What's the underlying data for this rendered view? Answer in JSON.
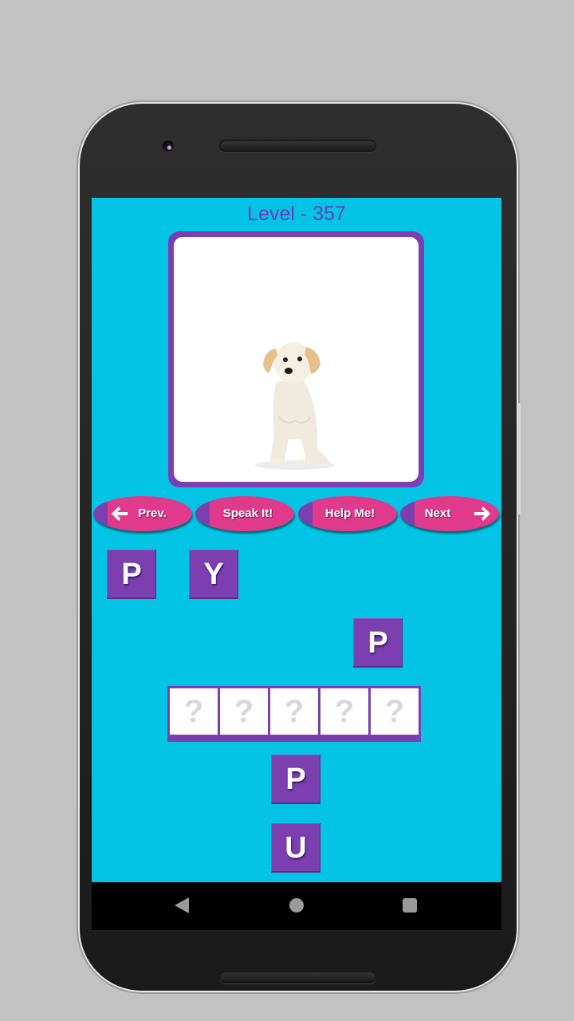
{
  "level": {
    "label": "Level - 357"
  },
  "picture": {
    "icon": "puppy-image",
    "alt": "puppy"
  },
  "buttons": {
    "prev": {
      "label": "Prev.",
      "icon": "arrow-left-icon"
    },
    "speak": {
      "label": "Speak It!"
    },
    "help": {
      "label": "Help Me!"
    },
    "next": {
      "label": "Next",
      "icon": "arrow-right-icon"
    }
  },
  "letter_tiles": [
    {
      "letter": "P"
    },
    {
      "letter": "Y"
    },
    {
      "letter": "P"
    },
    {
      "letter": "P"
    },
    {
      "letter": "U"
    }
  ],
  "answer_slots": [
    "?",
    "?",
    "?",
    "?",
    "?"
  ],
  "navbar": {
    "back": "back-icon",
    "home": "home-icon",
    "recents": "recents-icon"
  },
  "colors": {
    "background": "#04c4e6",
    "accent_purple": "#7b3fb0",
    "button_pink": "#e03a8c"
  }
}
